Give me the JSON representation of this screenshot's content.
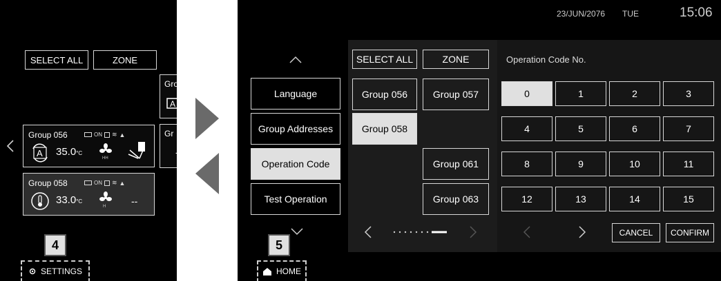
{
  "left_screen": {
    "select_all_label": "SELECT ALL",
    "zone_label": "ZONE",
    "partial_group_label_top": "Gro",
    "partial_group_label_mid": "Gr",
    "partial_group_value_mid": "-",
    "groups": [
      {
        "name": "Group 056",
        "status": "ON",
        "temp": "35.0",
        "unit": "°C",
        "fan_label": "HH",
        "selected": false
      },
      {
        "name": "Group 058",
        "status": "ON",
        "temp": "33.0",
        "unit": "°C",
        "fan_label": "H",
        "extra": "--",
        "selected": true
      }
    ],
    "badge_number": "4",
    "settings_label": "SETTINGS"
  },
  "right_screen": {
    "date": "23/JUN/2076",
    "day": "TUE",
    "time": "15:06",
    "menu": [
      {
        "label": "Language",
        "active": false
      },
      {
        "label": "Group Addresses",
        "active": false
      },
      {
        "label": "Operation Code",
        "active": true
      },
      {
        "label": "Test Operation",
        "active": false
      }
    ],
    "select_all_label": "SELECT ALL",
    "zone_label": "ZONE",
    "groups": {
      "g056": "Group 056",
      "g057": "Group 057",
      "g058": "Group 058",
      "g061": "Group 061",
      "g063": "Group 063"
    },
    "op_code_title": "Operation Code No.",
    "keys": [
      "0",
      "1",
      "2",
      "3",
      "4",
      "5",
      "6",
      "7",
      "8",
      "9",
      "10",
      "11",
      "12",
      "13",
      "14",
      "15"
    ],
    "cancel_label": "CANCEL",
    "confirm_label": "CONFIRM",
    "badge_number": "5",
    "home_label": "HOME"
  }
}
